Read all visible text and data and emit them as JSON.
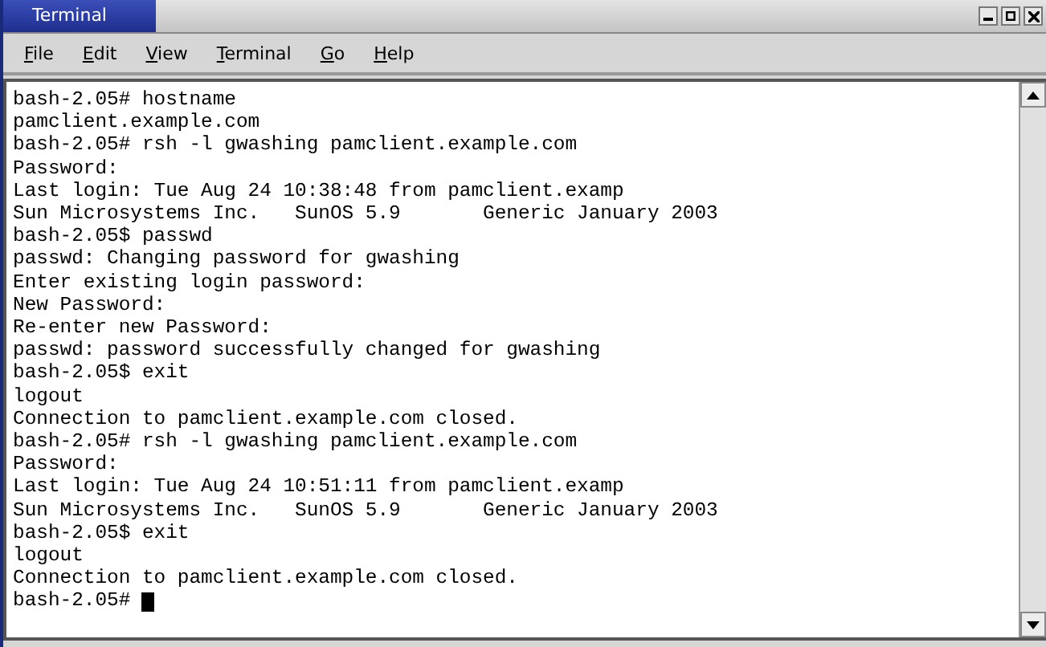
{
  "window": {
    "title": "Terminal"
  },
  "menu": [
    "File",
    "Edit",
    "View",
    "Terminal",
    "Go",
    "Help"
  ],
  "terminal": {
    "lines": [
      "bash-2.05# hostname",
      "pamclient.example.com",
      "bash-2.05# rsh -l gwashing pamclient.example.com",
      "Password:",
      "Last login: Tue Aug 24 10:38:48 from pamclient.examp",
      "Sun Microsystems Inc.   SunOS 5.9       Generic January 2003",
      "bash-2.05$ passwd",
      "passwd: Changing password for gwashing",
      "Enter existing login password:",
      "New Password:",
      "Re-enter new Password:",
      "passwd: password successfully changed for gwashing",
      "bash-2.05$ exit",
      "logout",
      "Connection to pamclient.example.com closed.",
      "bash-2.05# rsh -l gwashing pamclient.example.com",
      "Password:",
      "Last login: Tue Aug 24 10:51:11 from pamclient.examp",
      "Sun Microsystems Inc.   SunOS 5.9       Generic January 2003",
      "bash-2.05$ exit",
      "logout",
      "Connection to pamclient.example.com closed.",
      "bash-2.05# "
    ],
    "cursor": true
  }
}
